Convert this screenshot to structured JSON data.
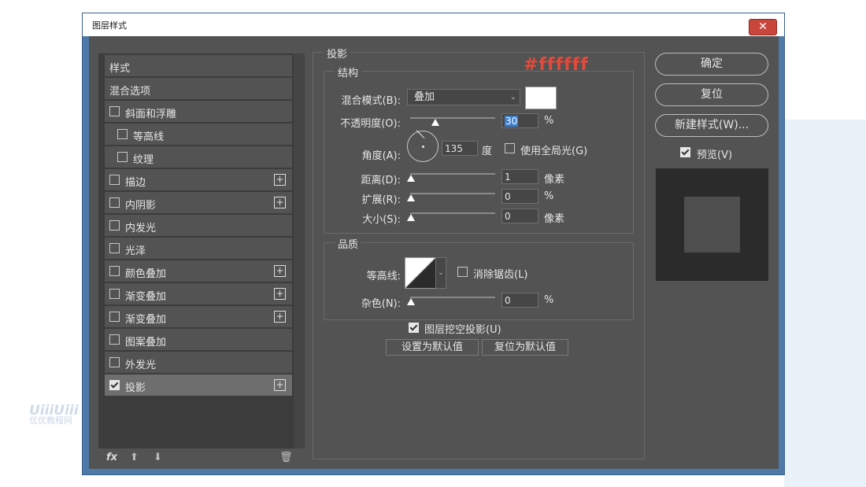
{
  "window": {
    "title": "图层样式",
    "close_label": "✕"
  },
  "left_panel": {
    "items": [
      {
        "label": "样式",
        "checkbox": false,
        "checked": false,
        "plus": false,
        "indent": 0
      },
      {
        "label": "混合选项",
        "checkbox": false,
        "checked": false,
        "plus": false,
        "indent": 0
      },
      {
        "label": "斜面和浮雕",
        "checkbox": true,
        "checked": false,
        "plus": false,
        "indent": 0
      },
      {
        "label": "等高线",
        "checkbox": true,
        "checked": false,
        "plus": false,
        "indent": 1
      },
      {
        "label": "纹理",
        "checkbox": true,
        "checked": false,
        "plus": false,
        "indent": 1
      },
      {
        "label": "描边",
        "checkbox": true,
        "checked": false,
        "plus": true,
        "indent": 0
      },
      {
        "label": "内阴影",
        "checkbox": true,
        "checked": false,
        "plus": true,
        "indent": 0
      },
      {
        "label": "内发光",
        "checkbox": true,
        "checked": false,
        "plus": false,
        "indent": 0
      },
      {
        "label": "光泽",
        "checkbox": true,
        "checked": false,
        "plus": false,
        "indent": 0
      },
      {
        "label": "颜色叠加",
        "checkbox": true,
        "checked": false,
        "plus": true,
        "indent": 0
      },
      {
        "label": "渐变叠加",
        "checkbox": true,
        "checked": false,
        "plus": true,
        "indent": 0
      },
      {
        "label": "渐变叠加",
        "checkbox": true,
        "checked": false,
        "plus": true,
        "indent": 0
      },
      {
        "label": "图案叠加",
        "checkbox": true,
        "checked": false,
        "plus": false,
        "indent": 0
      },
      {
        "label": "外发光",
        "checkbox": true,
        "checked": false,
        "plus": false,
        "indent": 0
      },
      {
        "label": "投影",
        "checkbox": true,
        "checked": true,
        "plus": true,
        "indent": 0
      }
    ],
    "toolbar": {
      "fx": "fx",
      "up": "⬆",
      "down": "⬇",
      "trash": "🗑"
    }
  },
  "drop_shadow": {
    "title": "投影",
    "structure": {
      "title": "结构",
      "blend_mode_label": "混合模式(B):",
      "blend_mode_value": "叠加",
      "color": "#ffffff",
      "opacity_label": "不透明度(O):",
      "opacity_value": "30",
      "opacity_unit": "%",
      "opacity_level": 0.3,
      "angle_label": "角度(A):",
      "angle_value": "135",
      "angle_unit": "度",
      "global_light_label": "使用全局光(G)",
      "global_light_checked": false,
      "distance_label": "距离(D):",
      "distance_value": "1",
      "distance_unit": "像素",
      "spread_label": "扩展(R):",
      "spread_value": "0",
      "spread_unit": "%",
      "size_label": "大小(S):",
      "size_value": "0",
      "size_unit": "像素"
    },
    "quality": {
      "title": "品质",
      "contour_label": "等高线:",
      "antialias_label": "消除锯齿(L)",
      "antialias_checked": false,
      "noise_label": "杂色(N):",
      "noise_value": "0",
      "noise_unit": "%"
    },
    "knockout_label": "图层挖空投影(U)",
    "knockout_checked": true,
    "make_default_label": "设置为默认值",
    "reset_default_label": "复位为默认值"
  },
  "annotation": "#ffffff",
  "buttons": {
    "ok": "确定",
    "reset": "复位",
    "new_style": "新建样式(W)...",
    "preview_label": "预览(V)",
    "preview_checked": true
  },
  "watermark": {
    "logo": "UiiiUiii",
    "text": "优优教程网"
  },
  "colors": {
    "panel": "#535353",
    "list_bg": "#3c3c3c",
    "selected": "#6e6e6e",
    "annotation": "#e24a3b",
    "titlebar_blue": "#4d7aa8",
    "close": "#c9463d"
  }
}
